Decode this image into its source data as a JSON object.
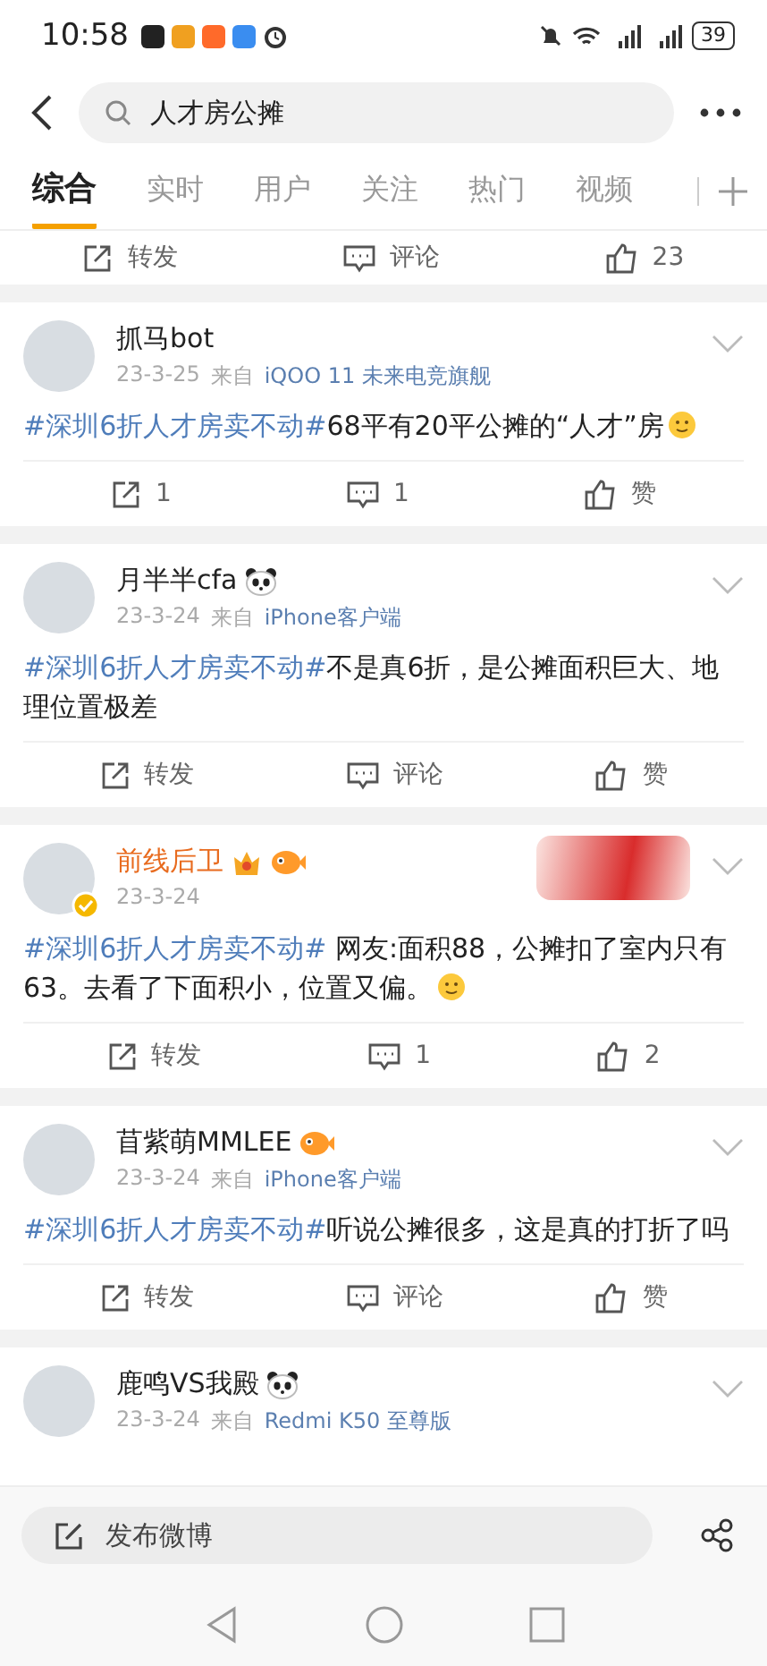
{
  "status_bar": {
    "time": "10:58",
    "battery": "39"
  },
  "search": {
    "query": "人才房公摊"
  },
  "tabs": [
    {
      "label": "综合",
      "selected": true
    },
    {
      "label": "实时",
      "selected": false
    },
    {
      "label": "用户",
      "selected": false
    },
    {
      "label": "关注",
      "selected": false
    },
    {
      "label": "热门",
      "selected": false
    },
    {
      "label": "视频",
      "selected": false
    }
  ],
  "partial_actions": [
    {
      "kind": "repost",
      "label": "转发"
    },
    {
      "kind": "comment",
      "label": "评论"
    },
    {
      "kind": "like",
      "label": "23"
    }
  ],
  "posts": [
    {
      "name": "抓马bot",
      "vip": false,
      "date": "23-3-25",
      "source_prefix": "来自",
      "source": "iQOO 11 未来电竞旗舰",
      "topic": "#深圳6折人才房卖不动#",
      "body": "68平有20平公摊的“人才”房",
      "end_emoji": true,
      "actions": [
        {
          "kind": "repost",
          "label": "1"
        },
        {
          "kind": "comment",
          "label": "1"
        },
        {
          "kind": "like",
          "label": "赞"
        }
      ]
    },
    {
      "name": "月半半cfa",
      "vip": false,
      "badges": [
        {
          "kind": "panda"
        }
      ],
      "date": "23-3-24",
      "source_prefix": "来自",
      "source": "iPhone客户端",
      "topic": "#深圳6折人才房卖不动#",
      "body": "不是真6折，是公摊面积巨大、地理位置极差",
      "actions": [
        {
          "kind": "repost",
          "label": "转发"
        },
        {
          "kind": "comment",
          "label": "评论"
        },
        {
          "kind": "like",
          "label": "赞"
        }
      ]
    },
    {
      "name": "前线后卫",
      "vip": true,
      "verified": true,
      "badges": [
        {
          "kind": "crown"
        },
        {
          "kind": "fish"
        }
      ],
      "decoration": true,
      "date": "23-3-24",
      "topic": "#深圳6折人才房卖不动#",
      "body": " 网友:面积88，公摊扣了室内只有63。去看了下面积小，位置又偏。",
      "end_emoji": true,
      "actions": [
        {
          "kind": "repost",
          "label": "转发"
        },
        {
          "kind": "comment",
          "label": "1"
        },
        {
          "kind": "like",
          "label": "2"
        }
      ]
    },
    {
      "name": "苜紫萌MMLEE",
      "vip": false,
      "badges": [
        {
          "kind": "fish"
        }
      ],
      "date": "23-3-24",
      "source_prefix": "来自",
      "source": "iPhone客户端",
      "topic": "#深圳6折人才房卖不动#",
      "body": "听说公摊很多，这是真的打折了吗",
      "actions": [
        {
          "kind": "repost",
          "label": "转发"
        },
        {
          "kind": "comment",
          "label": "评论"
        },
        {
          "kind": "like",
          "label": "赞"
        }
      ]
    },
    {
      "name": "鹿鸣VS我殿",
      "vip": false,
      "badges": [
        {
          "kind": "panda"
        }
      ],
      "date": "23-3-24",
      "source_prefix": "来自",
      "source": "Redmi K50 至尊版"
    }
  ],
  "compose": {
    "label": "发布微博"
  }
}
